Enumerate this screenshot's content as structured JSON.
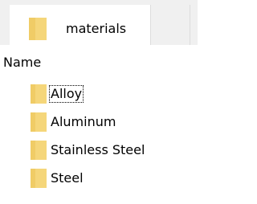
{
  "tab": {
    "label": "materials",
    "icon": "folder-icon"
  },
  "header": {
    "name_label": "Name"
  },
  "items": [
    {
      "label": "Alloy",
      "icon": "folder-icon",
      "focused": true
    },
    {
      "label": "Aluminum",
      "icon": "folder-icon",
      "focused": false
    },
    {
      "label": "Stainless Steel",
      "icon": "folder-icon",
      "focused": false
    },
    {
      "label": "Steel",
      "icon": "folder-icon",
      "focused": false
    }
  ],
  "colors": {
    "folder": "#f5d67a",
    "folder_dark": "#e8c15a"
  }
}
